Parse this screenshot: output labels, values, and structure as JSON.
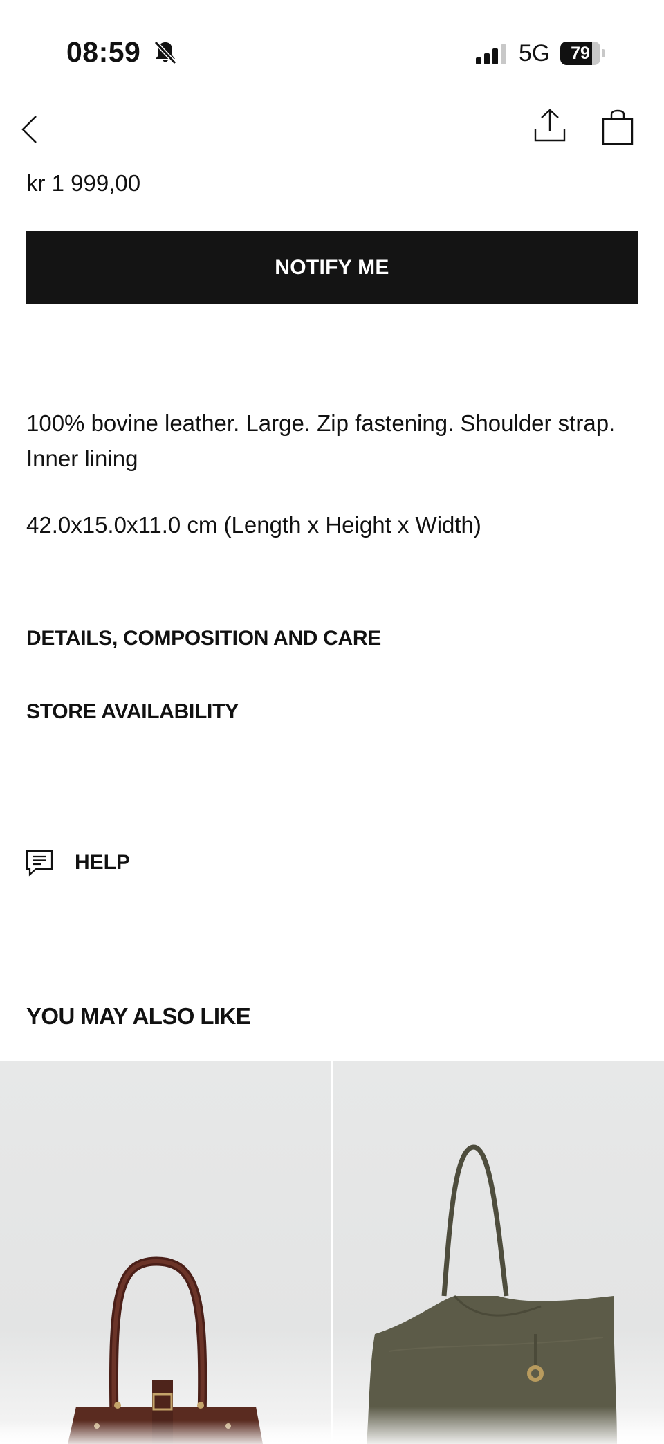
{
  "status_bar": {
    "time": "08:59",
    "network": "5G",
    "battery": "79",
    "battery_level_percent": 79,
    "icons": [
      "bell-slash-icon",
      "signal-icon"
    ]
  },
  "nav": {
    "icons": [
      "back-chevron-icon",
      "share-icon",
      "shopping-bag-icon"
    ]
  },
  "product": {
    "price": "kr 1 999,00",
    "notify_label": "NOTIFY ME",
    "description": "100% bovine leather. Large. Zip fastening. Shoulder strap. Inner lining",
    "dimensions": "42.0x15.0x11.0 cm (Length x Height x Width)"
  },
  "sections": {
    "details": "DETAILS, COMPOSITION AND CARE",
    "store": "STORE AVAILABILITY"
  },
  "help": {
    "label": "HELP",
    "icon": "chat-icon"
  },
  "recommendations": {
    "title": "YOU MAY ALSO LIKE",
    "items": [
      {
        "image": "brown-leather-bowling-bag",
        "color": "#5a2b20"
      },
      {
        "image": "olive-leather-tote-bag",
        "color": "#5b5a48"
      }
    ]
  }
}
